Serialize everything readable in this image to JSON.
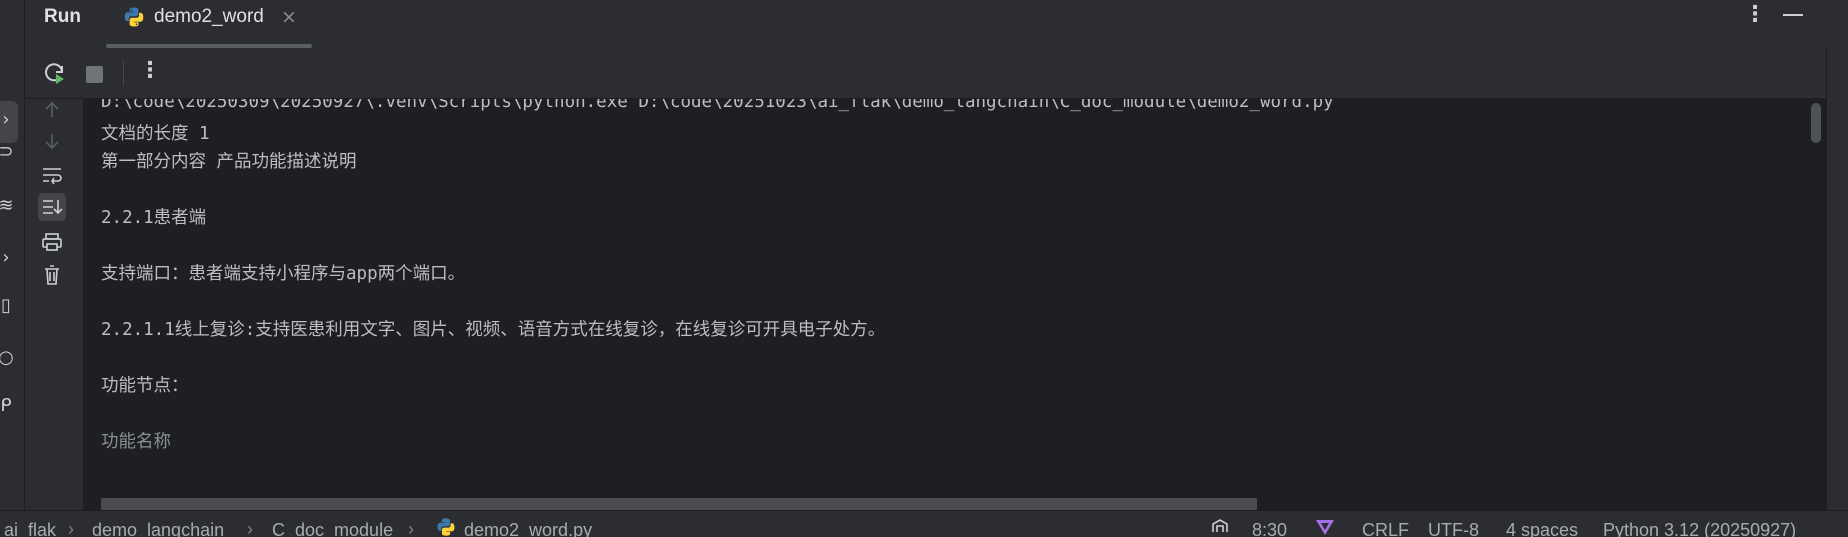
{
  "header": {
    "run_label": "Run",
    "tab_label": "demo2_word",
    "tab_close": "×",
    "more": "⋮"
  },
  "toolbar": {
    "more": "⋮"
  },
  "console": {
    "lines": [
      "D:\\code\\20250309\\20250927\\.venv\\Scripts\\python.exe D:\\code\\20251023\\ai_flak\\demo_langchain\\C_doc_module\\demo2_word.py",
      "文档的长度 1",
      "第一部分内容 产品功能描述说明",
      "",
      "2.2.1患者端",
      "",
      "支持端口：患者端支持小程序与app两个端口。",
      "",
      "2.2.1.1线上复诊:支持医患利用文字、图片、视频、语音方式在线复诊，在线复诊可开具电子处方。",
      "",
      "功能节点：",
      "",
      "功能名称"
    ]
  },
  "statusbar": {
    "breadcrumb": [
      "ai_flak",
      "demo_langchain",
      "C_doc_module",
      "demo2_word.py"
    ],
    "position": "8:30",
    "line_sep": "CRLF",
    "encoding": "UTF-8",
    "indent": "4 spaces",
    "interpreter": "Python 3.12 (20250927)"
  },
  "colors": {
    "background": "#1e1f22",
    "panel": "#2b2d30",
    "text": "#bcbec4",
    "python_blue": "#3c78aa",
    "python_yellow": "#ffd43b",
    "rerun_green": "#5fb865"
  }
}
